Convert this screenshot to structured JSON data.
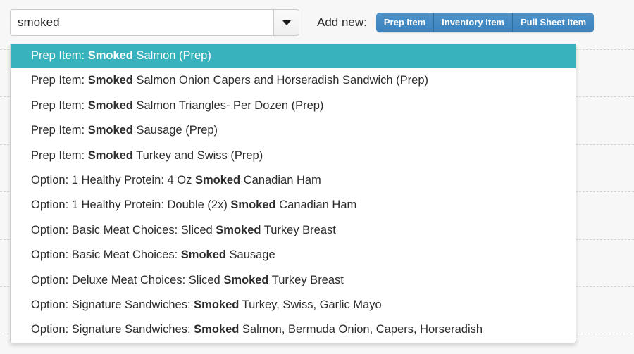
{
  "page": {
    "background_color": "#f7f7f7",
    "accent_teal": "#38b2bd",
    "button_blue": "#3b82bd"
  },
  "search": {
    "value": "smoked",
    "placeholder": "",
    "toggle_icon": "caret-down-icon"
  },
  "toolbar": {
    "add_new_label": "Add new:",
    "buttons": [
      {
        "label": "Prep Item"
      },
      {
        "label": "Inventory Item"
      },
      {
        "label": "Pull Sheet Item"
      }
    ]
  },
  "results": {
    "highlight_term": "Smoked",
    "selected_index": 0,
    "items": [
      {
        "prefix": "Prep Item: ",
        "term": "Smoked",
        "suffix": " Salmon (Prep)",
        "selected": true
      },
      {
        "prefix": "Prep Item: ",
        "term": "Smoked",
        "suffix": " Salmon Onion Capers and Horseradish Sandwich (Prep)",
        "selected": false
      },
      {
        "prefix": "Prep Item: ",
        "term": "Smoked",
        "suffix": " Salmon Triangles- Per Dozen (Prep)",
        "selected": false
      },
      {
        "prefix": "Prep Item: ",
        "term": "Smoked",
        "suffix": " Sausage (Prep)",
        "selected": false
      },
      {
        "prefix": "Prep Item: ",
        "term": "Smoked",
        "suffix": " Turkey and Swiss (Prep)",
        "selected": false
      },
      {
        "prefix": "Option: 1 Healthy Protein: 4 Oz ",
        "term": "Smoked",
        "suffix": " Canadian Ham",
        "selected": false
      },
      {
        "prefix": "Option: 1 Healthy Protein: Double (2x) ",
        "term": "Smoked",
        "suffix": " Canadian Ham",
        "selected": false
      },
      {
        "prefix": "Option: Basic Meat Choices: Sliced ",
        "term": "Smoked",
        "suffix": " Turkey Breast",
        "selected": false
      },
      {
        "prefix": "Option: Basic Meat Choices: ",
        "term": "Smoked",
        "suffix": " Sausage",
        "selected": false
      },
      {
        "prefix": "Option: Deluxe Meat Choices: Sliced ",
        "term": "Smoked",
        "suffix": " Turkey Breast",
        "selected": false
      },
      {
        "prefix": "Option: Signature Sandwiches: ",
        "term": "Smoked",
        "suffix": " Turkey, Swiss, Garlic Mayo",
        "selected": false
      },
      {
        "prefix": "Option: Signature Sandwiches: ",
        "term": "Smoked",
        "suffix": " Salmon, Bermuda Onion, Capers, Horseradish",
        "selected": false
      }
    ]
  },
  "background_rows": {
    "dash_y": [
      70,
      137,
      205,
      272,
      340,
      407,
      474
    ]
  }
}
